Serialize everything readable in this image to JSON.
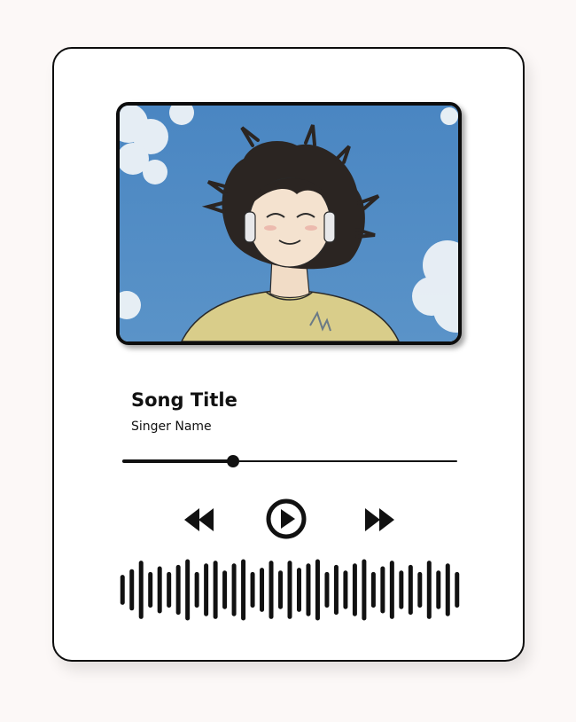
{
  "song": {
    "title": "Song Title",
    "singer": "Singer Name"
  },
  "playback": {
    "progress_fraction": 0.33,
    "state": "paused"
  },
  "controls": {
    "rewind_icon": "rewind-icon",
    "play_icon": "play-icon",
    "forward_icon": "fast-forward-icon"
  },
  "waveform": {
    "bar_levels": [
      0.45,
      0.65,
      0.95,
      0.55,
      0.75,
      0.55,
      0.8,
      1.0,
      0.55,
      0.85,
      0.95,
      0.6,
      0.85,
      1.0,
      0.55,
      0.7,
      0.95,
      0.6,
      0.95,
      0.7,
      0.85,
      1.0,
      0.55,
      0.8,
      0.6,
      0.85,
      1.0,
      0.55,
      0.75,
      0.95,
      0.6,
      0.8,
      0.55,
      0.95,
      0.6,
      0.85,
      0.55
    ]
  },
  "colors": {
    "ink": "#111111",
    "card_background": "#ffffff",
    "page_background": "#fcf8f7",
    "sky": "#4f8ac4"
  }
}
